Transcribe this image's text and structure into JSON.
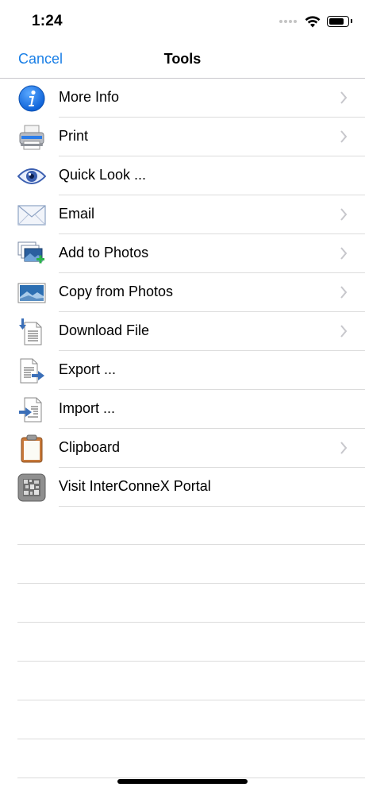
{
  "status": {
    "time": "1:24",
    "battery_level": 0.9
  },
  "nav": {
    "cancel_label": "Cancel",
    "title": "Tools"
  },
  "menu": [
    {
      "label": "More Info",
      "icon": "info-icon",
      "chevron": true
    },
    {
      "label": "Print",
      "icon": "printer-icon",
      "chevron": true
    },
    {
      "label": "Quick Look ...",
      "icon": "eye-icon",
      "chevron": false
    },
    {
      "label": "Email",
      "icon": "envelope-icon",
      "chevron": true
    },
    {
      "label": "Add to Photos",
      "icon": "add-photos-icon",
      "chevron": true
    },
    {
      "label": "Copy from Photos",
      "icon": "photo-icon",
      "chevron": true
    },
    {
      "label": "Download File",
      "icon": "download-file-icon",
      "chevron": true
    },
    {
      "label": "Export ...",
      "icon": "export-icon",
      "chevron": false
    },
    {
      "label": "Import ...",
      "icon": "import-icon",
      "chevron": false
    },
    {
      "label": "Clipboard",
      "icon": "clipboard-icon",
      "chevron": true
    },
    {
      "label": "Visit InterConneX Portal",
      "icon": "qr-code-icon",
      "chevron": false
    }
  ],
  "colors": {
    "accent": "#1a7fe6",
    "separator": "#dcdcdc",
    "chevron": "#c7c7cc"
  }
}
